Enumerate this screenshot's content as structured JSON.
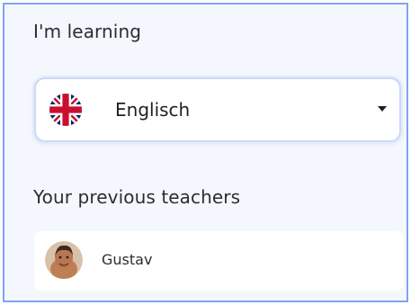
{
  "learning": {
    "label": "I'm learning",
    "language": {
      "value": "Englisch",
      "flag_icon": "uk-flag-icon",
      "dropdown_icon": "chevron-down-icon"
    }
  },
  "teachers": {
    "label": "Your previous teachers",
    "items": [
      {
        "name": "Gustav",
        "avatar": "teacher-avatar"
      }
    ]
  },
  "colors": {
    "panel_background": "#f4f7fd",
    "panel_border": "#7fa3f3",
    "select_border": "#c9d9f7",
    "text": "#2b2d33"
  }
}
